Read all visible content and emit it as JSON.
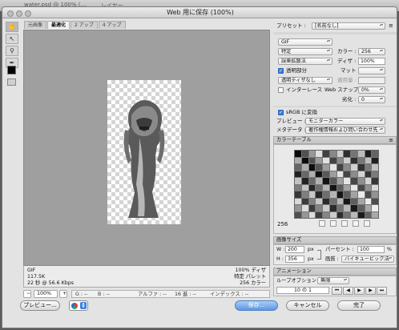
{
  "background": {
    "doc_title": "water.psd @ 100% (…",
    "layers_title": "レイヤー"
  },
  "window": {
    "title": "Web 用に保存 (100%)"
  },
  "tabs": [
    {
      "label": "元画像"
    },
    {
      "label": "最適化"
    },
    {
      "label": "2 アップ"
    },
    {
      "label": "4 アップ"
    }
  ],
  "info": {
    "format": "GIF",
    "size": "117.5K",
    "time": "22 秒 @ 56.6 Kbps",
    "dither": "100% ディザ",
    "palette": "特定 パレット",
    "colors": "256 カラー"
  },
  "zoom": {
    "value": "100%",
    "readout": {
      "g": "G : --",
      "b": "B : --",
      "alpha": "アルファ : --",
      "hex": "16 進 : --",
      "index": "インデックス : --"
    }
  },
  "buttons": {
    "preview": "プレビュー...",
    "save": "保存...",
    "cancel": "キャンセル",
    "done": "完了"
  },
  "settings": {
    "preset_label": "プリセット :",
    "preset_value": "[名前なし]",
    "format": "GIF",
    "reduction": "特定",
    "colors_label": "カラー :",
    "colors_value": "256",
    "dither_algo": "誤差拡散法",
    "dither_label": "ディザ :",
    "dither_value": "100%",
    "transparency_label": "透明部分",
    "matte_label": "マット :",
    "matte_value": "",
    "transparency_dither": "透明ディザなし",
    "amount_label": "適用量 :",
    "amount_value": "",
    "interlace_label": "インターレース",
    "websnap_label": "Web スナップ :",
    "websnap_value": "0%",
    "lossy_label": "劣化 :",
    "lossy_value": "0",
    "srgb_label": "sRGB に変換",
    "preview_label": "プレビュー :",
    "preview_value": "モニターカラー",
    "metadata_label": "メタデータ :",
    "metadata_value": "著作権情報および問い合わせ先"
  },
  "color_table": {
    "title": "カラーテーブル",
    "count": "256"
  },
  "image_size": {
    "title": "画像サイズ",
    "w_label": "W :",
    "w_value": "200",
    "h_label": "H :",
    "h_value": "356",
    "unit": "px",
    "percent_label": "パーセント :",
    "percent_value": "100",
    "percent_unit": "%",
    "quality_label": "画質 :",
    "quality_value": "バイキュービック法"
  },
  "animation": {
    "title": "アニメーション",
    "loop_label": "ループオプション :",
    "loop_value": "無限",
    "frame": "10 の 1"
  }
}
